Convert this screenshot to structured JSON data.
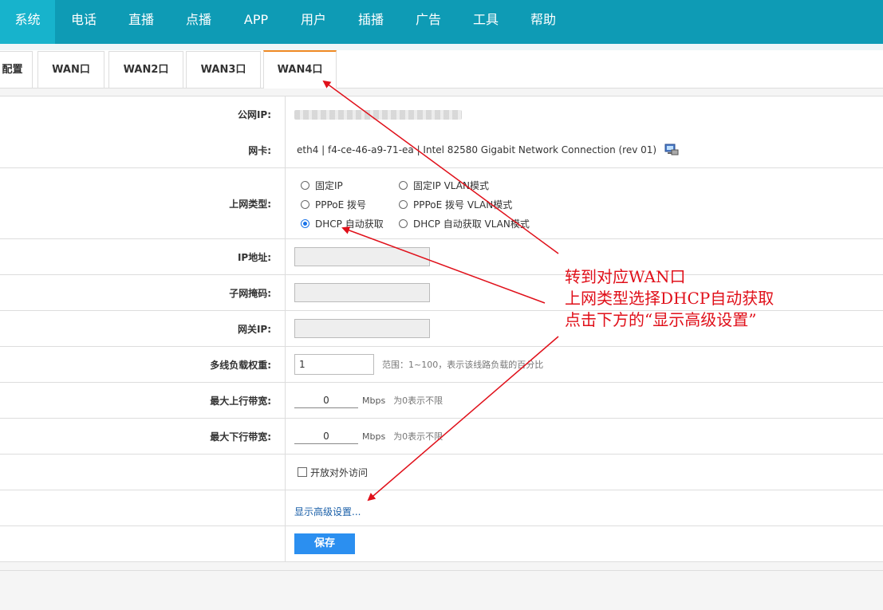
{
  "topnav": [
    "系统",
    "电话",
    "直播",
    "点播",
    "APP",
    "用户",
    "插播",
    "广告",
    "工具",
    "帮助"
  ],
  "tabs": [
    "配置",
    "WAN口",
    "WAN2口",
    "WAN3口",
    "WAN4口"
  ],
  "form": {
    "public_ip_label": "公网IP:",
    "nic_label": "网卡:",
    "nic_value": "eth4 | f4-ce-46-a9-71-ea | Intel 82580 Gigabit Network Connection (rev 01)",
    "conn_type_label": "上网类型:",
    "conn_types": [
      "固定IP",
      "固定IP VLAN模式",
      "PPPoE 拨号",
      "PPPoE 拨号 VLAN模式",
      "DHCP 自动获取",
      "DHCP 自动获取 VLAN模式"
    ],
    "ip_label": "IP地址:",
    "mask_label": "子网掩码:",
    "gateway_label": "网关IP:",
    "weight_label": "多线负载权重:",
    "weight_value": "1",
    "weight_hint": "范围：1~100，表示该线路负载的百分比",
    "up_label": "最大上行带宽:",
    "up_value": "0",
    "down_label": "最大下行带宽:",
    "down_value": "0",
    "unit": "Mbps",
    "unlimited_hint": "为0表示不限",
    "open_access": "开放对外访问",
    "advanced_link": "显示高级设置...",
    "save": "保存"
  },
  "annotation": {
    "line1": "转到对应WAN口",
    "line2": "上网类型选择DHCP自动获取",
    "line3": "点击下方的“显示高级设置”"
  },
  "colors": {
    "nav": "#0e9bb5",
    "nav_active": "#17b3cc",
    "tab_active": "#f08a24",
    "note": "#e0101a",
    "button": "#2b8ff0"
  }
}
